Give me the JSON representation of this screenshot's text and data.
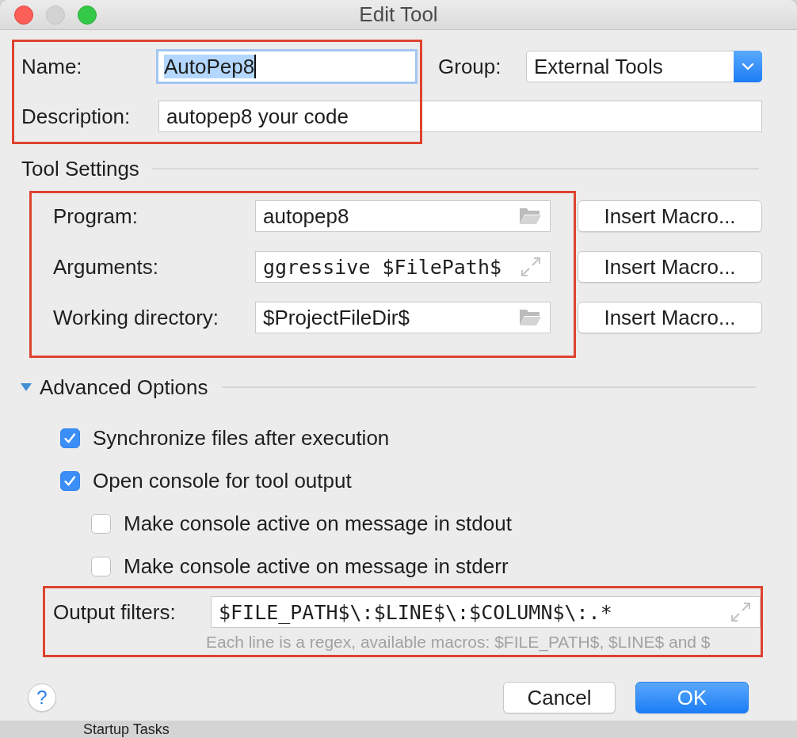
{
  "window": {
    "title": "Edit Tool"
  },
  "general": {
    "annotated": true,
    "name": {
      "label": "Name:",
      "value": "AutoPep8",
      "focused": true,
      "text_selected": true
    },
    "group": {
      "label": "Group:",
      "value": "External Tools"
    },
    "description": {
      "label": "Description:",
      "value": "autopep8 your code"
    }
  },
  "tool_settings": {
    "title": "Tool Settings",
    "annotated": true,
    "fields": [
      {
        "label": "Program:",
        "value": "autopep8",
        "kind": "browse",
        "button": "Insert Macro..."
      },
      {
        "label": "Arguments:",
        "value": "ggressive $FilePath$",
        "kind": "expand",
        "button": "Insert Macro..."
      },
      {
        "label": "Working directory:",
        "value": "$ProjectFileDir$",
        "kind": "browse",
        "button": "Insert Macro..."
      }
    ]
  },
  "advanced_options": {
    "title": "Advanced Options",
    "expanded": true,
    "options": [
      {
        "label": "Synchronize files after execution",
        "checked": true
      },
      {
        "label": "Open console for tool output",
        "checked": true,
        "children": [
          {
            "label": "Make console active on message in stdout",
            "checked": false
          },
          {
            "label": "Make console active on message in stderr",
            "checked": false
          }
        ]
      }
    ],
    "output_filters": {
      "annotated": true,
      "label": "Output filters:",
      "value": "$FILE_PATH$\\:$LINE$\\:$COLUMN$\\:.*",
      "kind": "expand",
      "hint": "Each line is a regex, available macros: $FILE_PATH$, $LINE$ and $"
    }
  },
  "help_button": {
    "label": "?"
  },
  "buttons": [
    {
      "label": "Cancel",
      "default": false
    },
    {
      "label": "OK",
      "default": true
    }
  ],
  "background_window": {
    "label": "Startup Tasks"
  }
}
